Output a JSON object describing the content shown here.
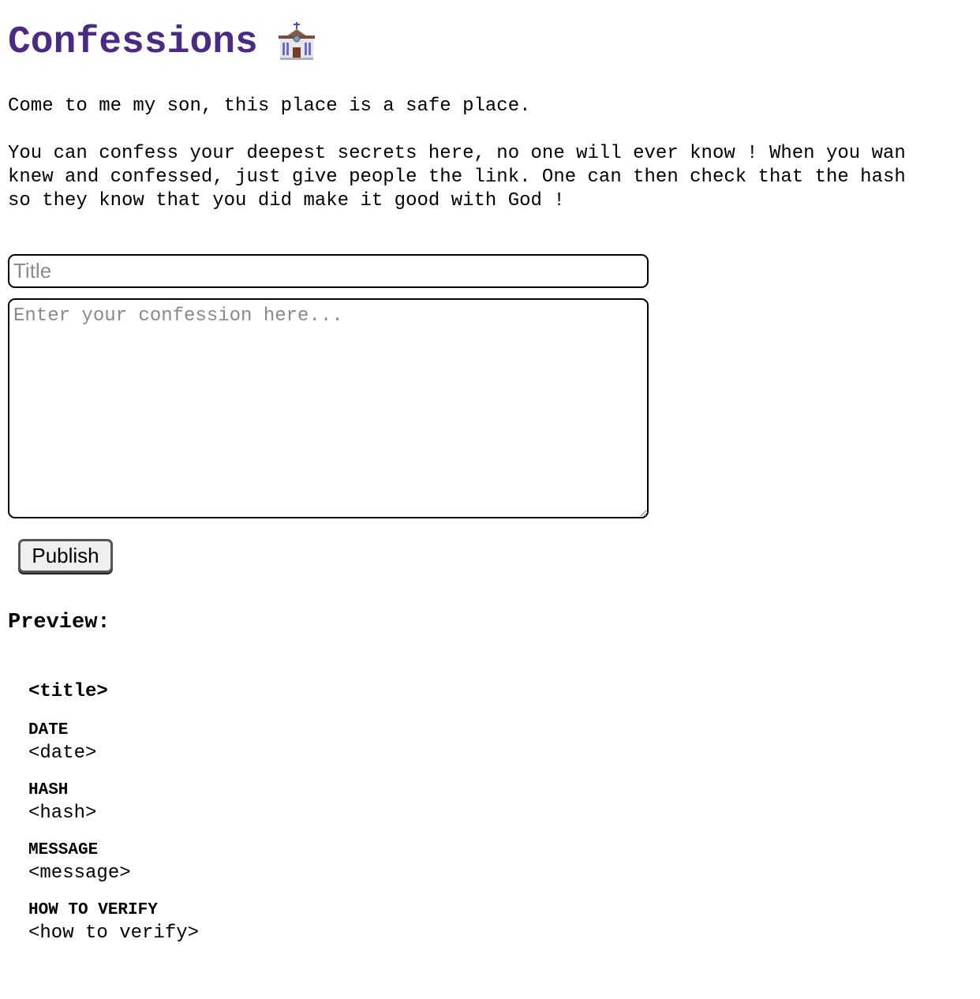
{
  "header": {
    "title": "Confessions"
  },
  "intro": "Come to me my son, this place is a safe place.",
  "description": {
    "line1": "You can confess your deepest secrets here, no one will ever know ! When you wan",
    "line2": "knew and confessed, just give people the link. One can then check that the hash",
    "line3": "so they know that you did make it good with God !"
  },
  "form": {
    "title_placeholder": "Title",
    "title_value": "",
    "confession_placeholder": "Enter your confession here...",
    "confession_value": "",
    "publish_label": "Publish"
  },
  "preview": {
    "heading": "Preview:",
    "title": "<title>",
    "fields": [
      {
        "label": "DATE",
        "value": "<date>"
      },
      {
        "label": "HASH",
        "value": "<hash>"
      },
      {
        "label": "MESSAGE",
        "value": "<message>"
      },
      {
        "label": "HOW TO VERIFY",
        "value": "<how to verify>"
      }
    ]
  },
  "icons": {
    "title_icon": "church-icon"
  },
  "colors": {
    "title": "#4b2a86"
  }
}
